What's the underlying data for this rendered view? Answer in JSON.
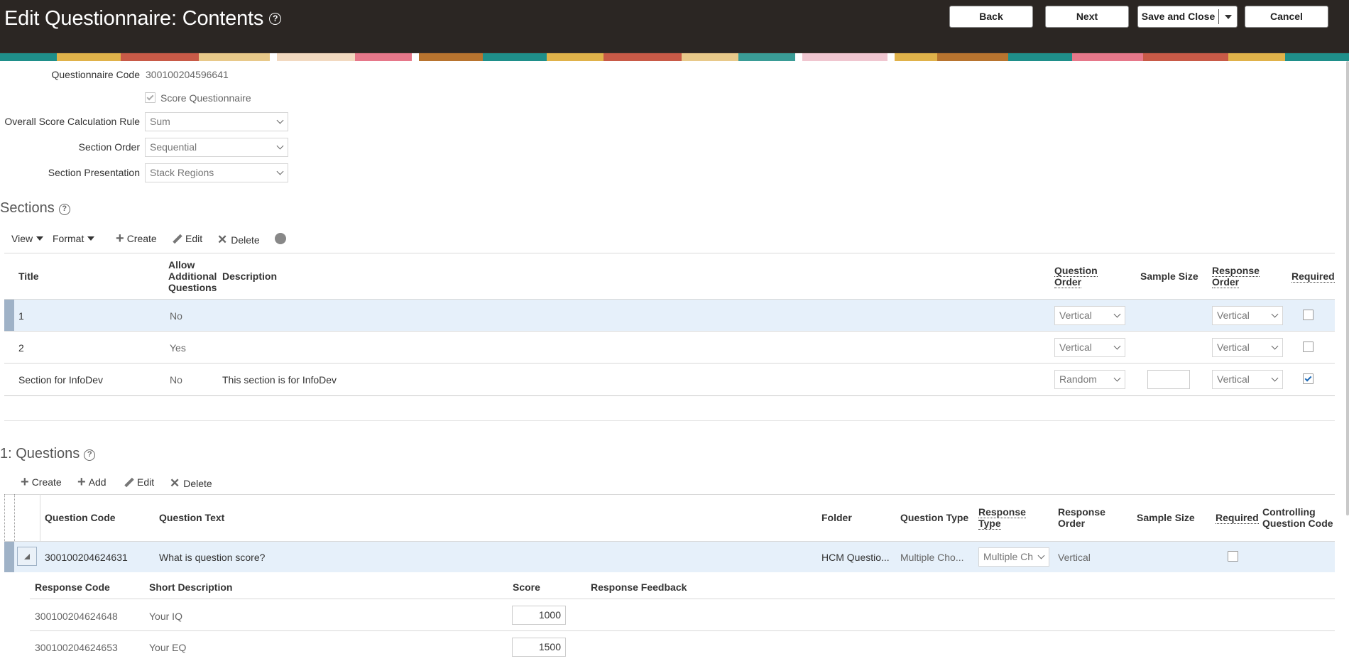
{
  "header": {
    "title": "Edit Questionnaire: Contents",
    "buttons": {
      "back": "Back",
      "next": "Next",
      "save_close": "Save and Close",
      "cancel": "Cancel"
    }
  },
  "form": {
    "questionnaire_code_label": "Questionnaire Code",
    "questionnaire_code": "300100204596641",
    "score_questionnaire_label": "Score Questionnaire",
    "score_questionnaire_checked": true,
    "overall_rule_label": "Overall Score Calculation Rule",
    "overall_rule_value": "Sum",
    "section_order_label": "Section Order",
    "section_order_value": "Sequential",
    "section_presentation_label": "Section Presentation",
    "section_presentation_value": "Stack Regions"
  },
  "sections": {
    "title": "Sections",
    "toolbar": {
      "view": "View",
      "format": "Format",
      "create": "Create",
      "edit": "Edit",
      "delete": "Delete"
    },
    "columns": {
      "title": "Title",
      "allow_additional": "Allow Additional Questions",
      "description": "Description",
      "question_order": "Question Order",
      "sample_size": "Sample Size",
      "response_order": "Response Order",
      "required": "Required"
    },
    "rows": [
      {
        "title": "1",
        "allow": "No",
        "description": "",
        "question_order": "Vertical",
        "sample_size": "",
        "response_order": "Vertical",
        "required": false,
        "selected": true
      },
      {
        "title": "2",
        "allow": "Yes",
        "description": "",
        "question_order": "Vertical",
        "sample_size": "",
        "response_order": "Vertical",
        "required": false,
        "selected": false
      },
      {
        "title": "Section for InfoDev",
        "allow": "No",
        "description": "This section is for InfoDev",
        "question_order": "Random",
        "sample_size": "",
        "response_order": "Vertical",
        "required": true,
        "selected": false
      }
    ]
  },
  "questions": {
    "title": "1: Questions",
    "toolbar": {
      "create": "Create",
      "add": "Add",
      "edit": "Edit",
      "delete": "Delete"
    },
    "columns": {
      "code": "Question Code",
      "text": "Question Text",
      "folder": "Folder",
      "type": "Question Type",
      "response_type": "Response Type",
      "response_order": "Response Order",
      "sample_size": "Sample Size",
      "required": "Required",
      "controlling": "Controlling Question Code"
    },
    "rows": [
      {
        "code": "300100204624631",
        "text": "What is question score?",
        "folder": "HCM Questio...",
        "type": "Multiple Cho...",
        "response_type": "Multiple Ch",
        "response_order": "Vertical",
        "required": false
      }
    ],
    "responses": {
      "columns": {
        "code": "Response Code",
        "short_desc": "Short Description",
        "score": "Score",
        "feedback": "Response Feedback"
      },
      "rows": [
        {
          "code": "300100204624648",
          "short_desc": "Your IQ",
          "score": "1000"
        },
        {
          "code": "300100204624653",
          "short_desc": "Your EQ",
          "score": "1500"
        }
      ]
    }
  }
}
